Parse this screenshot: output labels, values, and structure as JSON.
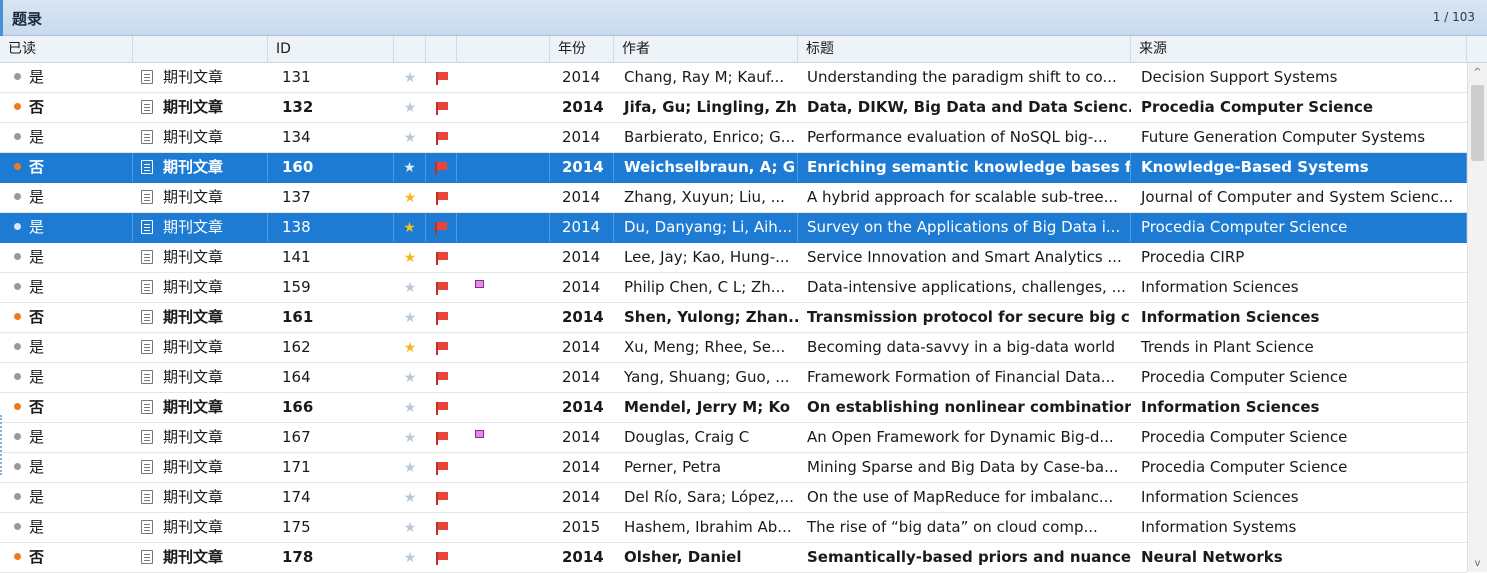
{
  "panel": {
    "title": "题录",
    "pager": "1 / 103"
  },
  "columns": {
    "read": "已读",
    "type": "",
    "id": "ID",
    "star": "",
    "flag": "",
    "tag": "",
    "year": "年份",
    "author": "作者",
    "title": "标题",
    "source": "来源"
  },
  "rows": [
    {
      "read": "是",
      "type": "期刊文章",
      "id": "131",
      "star": false,
      "tag": false,
      "year": "2014",
      "author": "Chang, Ray M; Kauf...",
      "title": "Understanding the paradigm shift to co...",
      "source": "Decision Support Systems",
      "unread": false,
      "selected": false
    },
    {
      "read": "否",
      "type": "期刊文章",
      "id": "132",
      "star": false,
      "tag": false,
      "year": "2014",
      "author": "Jifa, Gu; Lingling, Zh",
      "title": "Data, DIKW, Big Data and Data Scienc.",
      "source": "Procedia Computer Science",
      "unread": true,
      "selected": false
    },
    {
      "read": "是",
      "type": "期刊文章",
      "id": "134",
      "star": false,
      "tag": false,
      "year": "2014",
      "author": "Barbierato, Enrico; G...",
      "title": "Performance evaluation of NoSQL big-...",
      "source": "Future Generation Computer Systems",
      "unread": false,
      "selected": false
    },
    {
      "read": "否",
      "type": "期刊文章",
      "id": "160",
      "star": false,
      "tag": false,
      "year": "2014",
      "author": "Weichselbraun, A; G",
      "title": "Enriching semantic knowledge bases f",
      "source": "Knowledge-Based Systems",
      "unread": true,
      "selected": true
    },
    {
      "read": "是",
      "type": "期刊文章",
      "id": "137",
      "star": true,
      "tag": false,
      "year": "2014",
      "author": "Zhang, Xuyun; Liu, ...",
      "title": "A hybrid approach for scalable sub-tree...",
      "source": "Journal of Computer and System Scienc...",
      "unread": false,
      "selected": false
    },
    {
      "read": "是",
      "type": "期刊文章",
      "id": "138",
      "star": true,
      "tag": false,
      "year": "2014",
      "author": "Du, Danyang; Li, Aih...",
      "title": "Survey on the Applications of Big Data i...",
      "source": "Procedia Computer Science",
      "unread": false,
      "selected": true
    },
    {
      "read": "是",
      "type": "期刊文章",
      "id": "141",
      "star": true,
      "tag": false,
      "year": "2014",
      "author": "Lee, Jay; Kao, Hung-...",
      "title": "Service Innovation and Smart Analytics ...",
      "source": "Procedia CIRP",
      "unread": false,
      "selected": false
    },
    {
      "read": "是",
      "type": "期刊文章",
      "id": "159",
      "star": false,
      "tag": true,
      "year": "2014",
      "author": "Philip Chen, C L; Zh...",
      "title": "Data-intensive applications, challenges, ...",
      "source": "Information Sciences",
      "unread": false,
      "selected": false
    },
    {
      "read": "否",
      "type": "期刊文章",
      "id": "161",
      "star": false,
      "tag": false,
      "year": "2014",
      "author": "Shen, Yulong; Zhan..",
      "title": "Transmission protocol for secure big c",
      "source": "Information Sciences",
      "unread": true,
      "selected": false
    },
    {
      "read": "是",
      "type": "期刊文章",
      "id": "162",
      "star": true,
      "tag": false,
      "year": "2014",
      "author": "Xu, Meng; Rhee, Se...",
      "title": "Becoming data-savvy in a big-data world",
      "source": "Trends in Plant Science",
      "unread": false,
      "selected": false
    },
    {
      "read": "是",
      "type": "期刊文章",
      "id": "164",
      "star": false,
      "tag": false,
      "year": "2014",
      "author": "Yang, Shuang; Guo, ...",
      "title": "Framework Formation of Financial Data...",
      "source": "Procedia Computer Science",
      "unread": false,
      "selected": false
    },
    {
      "read": "否",
      "type": "期刊文章",
      "id": "166",
      "star": false,
      "tag": false,
      "year": "2014",
      "author": "Mendel, Jerry M; Ko",
      "title": "On establishing nonlinear combinatior",
      "source": "Information Sciences",
      "unread": true,
      "selected": false
    },
    {
      "read": "是",
      "type": "期刊文章",
      "id": "167",
      "star": false,
      "tag": true,
      "year": "2014",
      "author": "Douglas, Craig C",
      "title": "An Open Framework for Dynamic Big-d...",
      "source": "Procedia Computer Science",
      "unread": false,
      "selected": false
    },
    {
      "read": "是",
      "type": "期刊文章",
      "id": "171",
      "star": false,
      "tag": false,
      "year": "2014",
      "author": "Perner, Petra",
      "title": "Mining Sparse and Big Data by Case-ba...",
      "source": "Procedia Computer Science",
      "unread": false,
      "selected": false
    },
    {
      "read": "是",
      "type": "期刊文章",
      "id": "174",
      "star": false,
      "tag": false,
      "year": "2014",
      "author": "Del Río, Sara; López,...",
      "title": "On the use of MapReduce for imbalanc...",
      "source": "Information Sciences",
      "unread": false,
      "selected": false
    },
    {
      "read": "是",
      "type": "期刊文章",
      "id": "175",
      "star": false,
      "tag": false,
      "year": "2015",
      "author": "Hashem, Ibrahim Ab...",
      "title": "The rise of “big data” on cloud comp...",
      "source": "Information Systems",
      "unread": false,
      "selected": false
    },
    {
      "read": "否",
      "type": "期刊文章",
      "id": "178",
      "star": false,
      "tag": false,
      "year": "2014",
      "author": "Olsher, Daniel",
      "title": "Semantically-based priors and nuance",
      "source": "Neural Networks",
      "unread": true,
      "selected": false
    }
  ],
  "colors": {
    "accent": "#1e7bd3",
    "unread_dot": "#f07a1a",
    "star_on": "#f6b51a",
    "flag": "#e8443a"
  }
}
